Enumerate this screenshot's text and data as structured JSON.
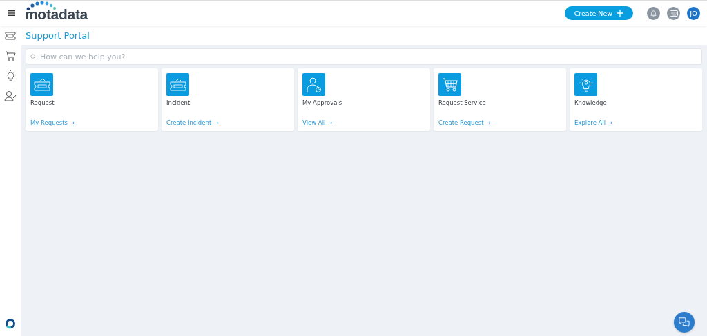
{
  "header": {
    "logo": "motadata",
    "create_button": "Create New",
    "avatar": "JO"
  },
  "sidebar": {
    "items": [
      {
        "kind": "ticket",
        "selected": false
      },
      {
        "kind": "cart",
        "selected": false
      },
      {
        "kind": "bulb",
        "selected": false
      },
      {
        "kind": "approval",
        "selected": false
      }
    ]
  },
  "page": {
    "title": "Support Portal",
    "search": {
      "placeholder": "How can we help you?"
    }
  },
  "cards": [
    {
      "kind": "ticket",
      "title": "Request",
      "link": "My Requests →"
    },
    {
      "kind": "ticket",
      "title": "Incident",
      "link": "Create Incident →"
    },
    {
      "kind": "approval",
      "title": "My Approvals",
      "link": "View All →"
    },
    {
      "kind": "cart",
      "title": "Request Service",
      "link": "Create Request →"
    },
    {
      "kind": "bulb",
      "title": "Knowledge",
      "link": "Explore All →"
    }
  ]
}
